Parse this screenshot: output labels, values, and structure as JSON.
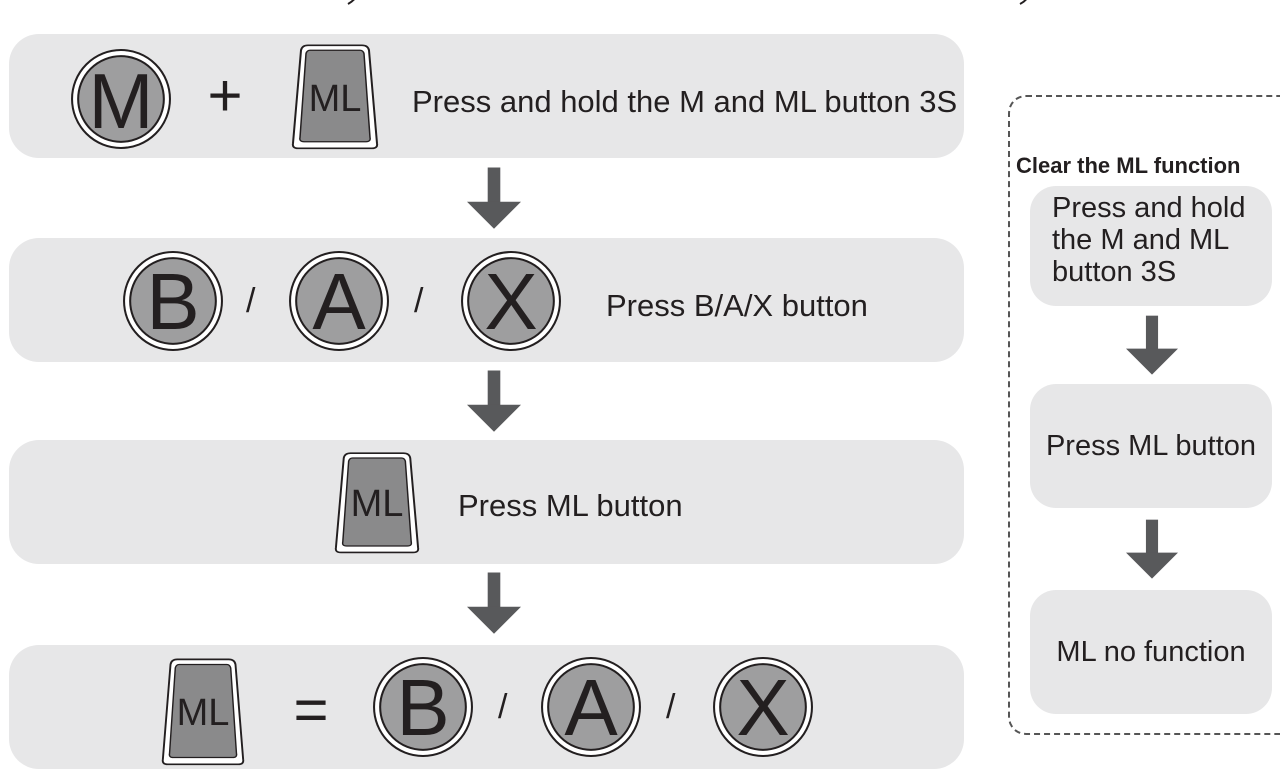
{
  "steps": [
    {
      "label": "Press and hold the M and ML button 3S",
      "buttons": [
        "M",
        "ML"
      ],
      "operator": "+"
    },
    {
      "label": "Press B/A/X button",
      "buttons": [
        "B",
        "A",
        "X"
      ],
      "separator": "/"
    },
    {
      "label": "Press ML button",
      "buttons": [
        "ML"
      ]
    },
    {
      "label": "",
      "buttons": [
        "ML",
        "B",
        "A",
        "X"
      ],
      "operator": "=",
      "separator": "/"
    }
  ],
  "icons": {
    "round": "round-button-icon",
    "trigger": "trigger-button-icon",
    "arrow": "down-arrow-icon"
  },
  "clear": {
    "title": "Clear the ML function",
    "steps": [
      {
        "line1": "Press and hold",
        "line2": "the M and ML",
        "line3": "button 3S"
      },
      {
        "label": "Press ML button"
      },
      {
        "label": "ML no function"
      }
    ]
  },
  "colors": {
    "panel": "#e7e7e8",
    "button_fill": "#9e9e9f",
    "arrow": "#58595b",
    "text": "#231f20"
  }
}
